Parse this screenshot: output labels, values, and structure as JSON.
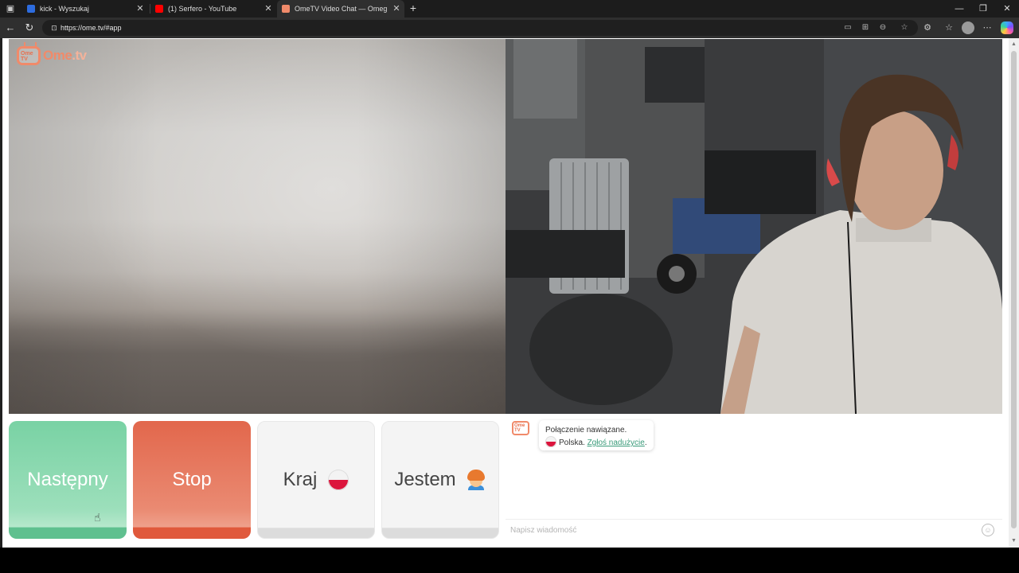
{
  "browser": {
    "tabs": [
      {
        "title": "kick - Wyszukaj",
        "favicon": "search-icon",
        "active": false
      },
      {
        "title": "(1) Serfero - YouTube",
        "favicon": "youtube-icon",
        "active": false
      },
      {
        "title": "OmeTV Video Chat — Omeg",
        "favicon": "ometv-icon",
        "active": true
      }
    ],
    "new_tab_symbol": "+",
    "url": "https://ome.tv/#app",
    "window_controls": {
      "minimize": "—",
      "maximize": "❐",
      "close": "✕"
    }
  },
  "app": {
    "logo_text": "Ome",
    "logo_dot": ".tv",
    "logo_badge": "Ome TV",
    "accent_color": "#f08a6a"
  },
  "controls": {
    "next_label": "Następny",
    "stop_label": "Stop",
    "country_label": "Kraj",
    "gender_label": "Jestem",
    "next_color": "#79d2a4",
    "stop_color": "#e2674c"
  },
  "chat": {
    "badge": "Ome TV",
    "message_line1": "Połączenie nawiązane.",
    "message_country": "Polska.",
    "message_link": "Zgłoś nadużycie",
    "message_end": ".",
    "input_placeholder": "Napisz wiadomość",
    "link_color": "#3a9b7a"
  }
}
